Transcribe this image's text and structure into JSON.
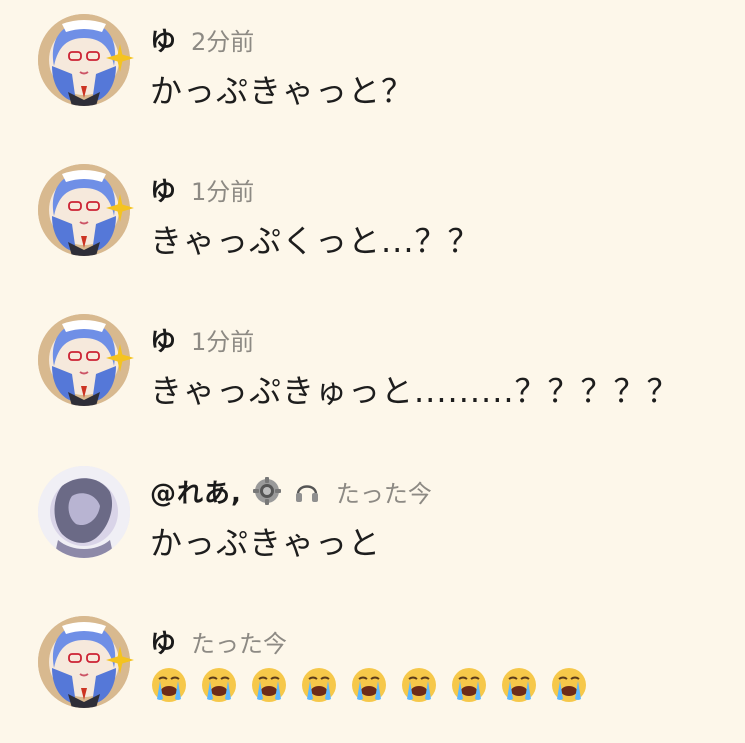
{
  "messages": [
    {
      "name": "ゆ",
      "time": "2分前",
      "text": "かっぷきゃっと？",
      "avatar": "yu-avatar"
    },
    {
      "name": "ゆ",
      "time": "1分前",
      "text": "きゃっぷくっと...？？",
      "avatar": "yu-avatar"
    },
    {
      "name": "ゆ",
      "time": "1分前",
      "text": "きゃっぷきゅっと.........？？？？？",
      "avatar": "yu-avatar"
    },
    {
      "name": "@れあ,",
      "time": "たった今",
      "text": "かっぷきゃっと",
      "avatar": "rea-avatar",
      "badges": [
        "gear-icon",
        "headphones-icon"
      ]
    },
    {
      "name": "ゆ",
      "time": "たった今",
      "emoji": [
        "😭",
        "😭",
        "😭",
        "😭",
        "😭",
        "😭",
        "😭",
        "😭",
        "😭"
      ],
      "avatar": "yu-avatar"
    }
  ],
  "colors": {
    "background": "#fdf7ea",
    "name": "#1a1a1a",
    "time": "#8d8a84",
    "text": "#1d1d1d"
  }
}
